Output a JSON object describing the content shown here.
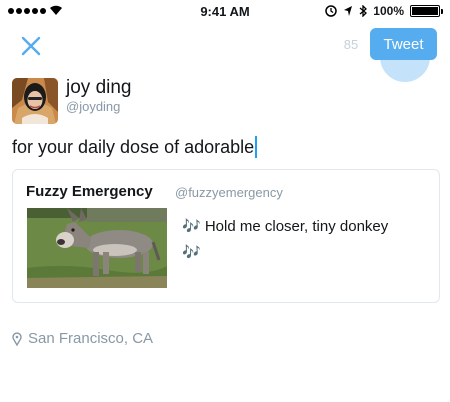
{
  "status_bar": {
    "time": "9:41 AM",
    "battery": "100%",
    "battery_level": 1.0,
    "icons": [
      "signal-dots-icon",
      "wifi-icon",
      "alarm-icon",
      "location-arrow-icon",
      "bluetooth-icon",
      "battery-icon"
    ]
  },
  "toolbar": {
    "close_icon": "close-icon",
    "char_count": "85",
    "tweet_label": "Tweet"
  },
  "author": {
    "display_name": "joy ding",
    "username": "@joyding"
  },
  "compose": {
    "text": "for your daily dose of adorable"
  },
  "quote": {
    "name": "Fuzzy Emergency",
    "handle": "@fuzzyemergency",
    "text_line1": "🎶 Hold me closer, tiny donkey",
    "text_line2": "🎶"
  },
  "location": {
    "icon": "location-pin-icon",
    "label": "San Francisco, CA"
  },
  "colors": {
    "accent": "#55acee",
    "caret": "#1da1f2",
    "muted_text": "#8899a6",
    "border": "#e1e8ed"
  }
}
